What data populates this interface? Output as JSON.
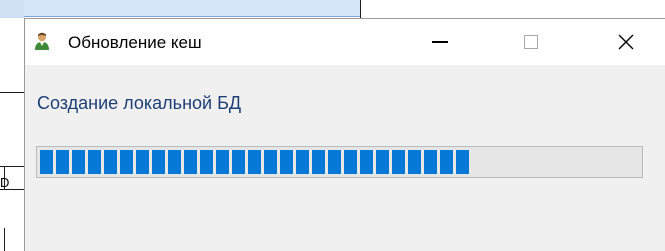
{
  "dialog": {
    "title": "Обновление кеш",
    "icon": "user-icon",
    "status_text": "Создание локальной БД",
    "progress": {
      "value": 0.71
    }
  },
  "background_window": {
    "partial_glyph": "D"
  },
  "colors": {
    "accent": "#0679d6",
    "status_text": "#1e3f75",
    "dialog_bg": "#f0f0f0",
    "titlebar_bg": "#ffffff"
  }
}
